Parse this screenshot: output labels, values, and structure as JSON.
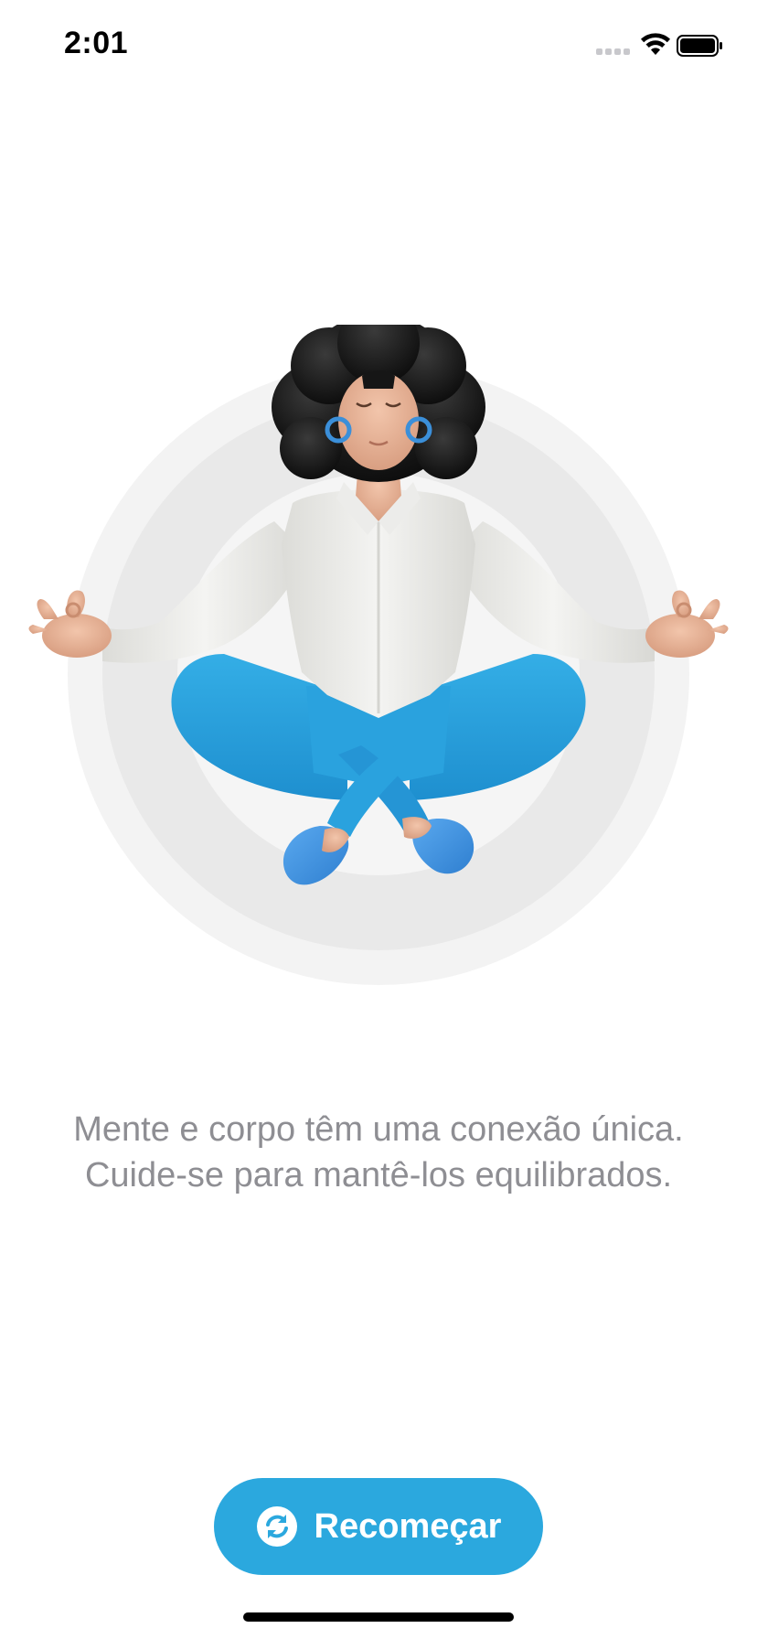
{
  "status_bar": {
    "time": "2:01",
    "icons": [
      "cellular-signal-icon",
      "wifi-icon",
      "battery-icon"
    ]
  },
  "illustration": {
    "subject": "meditating-woman-illustration",
    "colors": {
      "ring_outer": "#f3f3f3",
      "ring_mid": "#e9e9e9",
      "ring_inner": "#f6f6f6",
      "shirt": "#efefed",
      "pants": "#2a9fdc",
      "shoes": "#4a9be6",
      "skin": "#e8b79b",
      "hair": "#1a1a1a",
      "earrings": "#3b8fd9"
    }
  },
  "message": {
    "line1": "Mente e corpo têm uma conexão única.",
    "line2": "Cuide-se para mantê-los equilibrados."
  },
  "restart_button": {
    "label": "Recomeçar",
    "icon": "refresh-icon",
    "color": "#2ba8de"
  }
}
